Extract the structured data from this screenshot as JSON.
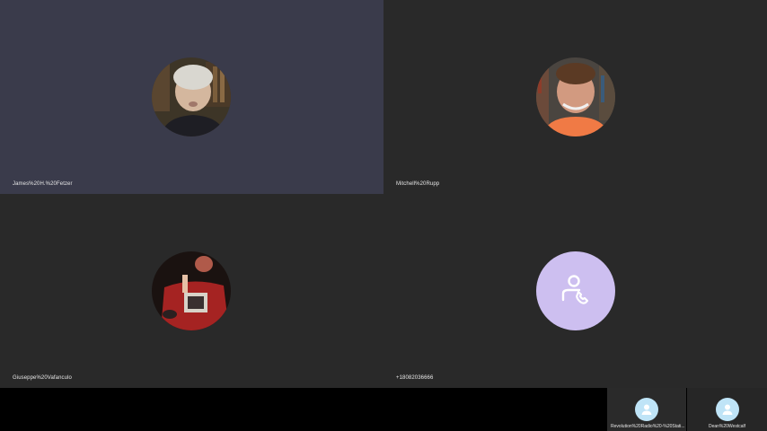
{
  "participants": [
    {
      "name": "James%20H.%20Fetzer",
      "avatar": "video-feed-man-white-hair"
    },
    {
      "name": "Mitchell%20Rupp",
      "avatar": "video-feed-man-orange-shirt"
    },
    {
      "name": "Giuseppe%20Vafanculo",
      "avatar": "video-feed-man-red-shirt"
    },
    {
      "name": "+18082036666",
      "avatar": "phone-person-icon"
    }
  ],
  "strip": [
    {
      "name": "Revolution%20Radio%20-%20Stati...",
      "avatar": "person-icon"
    },
    {
      "name": "Dean%20Westcalf",
      "avatar": "person-icon"
    }
  ],
  "colors": {
    "active_tile": "#3a3b4b",
    "tile": "#292929",
    "phone_avatar": "#cdbff0",
    "mini_avatar": "#bfe4f7"
  }
}
